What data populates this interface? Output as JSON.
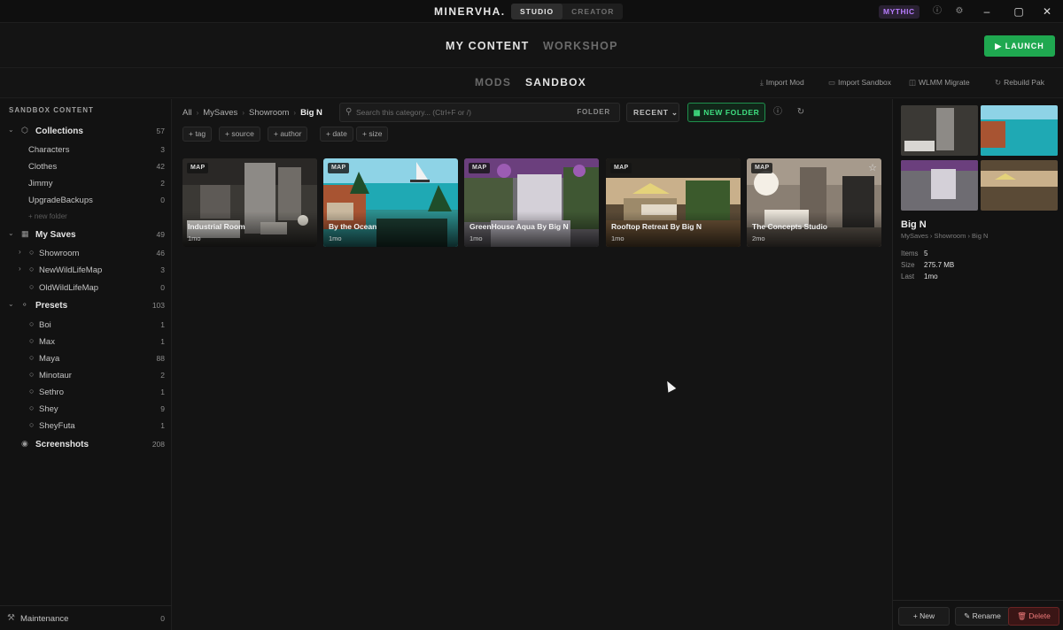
{
  "app": {
    "brand": "MINERVHA.",
    "modes": [
      "STUDIO",
      "CREATOR"
    ],
    "tier_badge": "MYTHIC"
  },
  "primary_nav": {
    "tabs": [
      "MY CONTENT",
      "WORKSHOP"
    ],
    "active": "MY CONTENT",
    "launch_label": "LAUNCH"
  },
  "secondary_nav": {
    "tabs": [
      "MODS",
      "SANDBOX"
    ],
    "active": "SANDBOX",
    "actions": [
      "Import Mod",
      "Import Sandbox",
      "WLMM Migrate",
      "Rebuild Pak"
    ]
  },
  "sidebar": {
    "header": "SANDBOX CONTENT",
    "collections": {
      "label": "Collections",
      "count": "57",
      "items": [
        {
          "label": "Characters",
          "count": "3"
        },
        {
          "label": "Clothes",
          "count": "42"
        },
        {
          "label": "Jimmy",
          "count": "2"
        },
        {
          "label": "UpgradeBackups",
          "count": "0"
        }
      ],
      "new_folder": "+ new folder"
    },
    "my_saves": {
      "label": "My Saves",
      "count": "49",
      "items": [
        {
          "label": "Showroom",
          "count": "46"
        },
        {
          "label": "NewWildLifeMap",
          "count": "3"
        },
        {
          "label": "OldWildLifeMap",
          "count": "0"
        }
      ]
    },
    "presets": {
      "label": "Presets",
      "count": "103",
      "items": [
        {
          "label": "Boi",
          "count": "1"
        },
        {
          "label": "Max",
          "count": "1"
        },
        {
          "label": "Maya",
          "count": "88"
        },
        {
          "label": "Minotaur",
          "count": "2"
        },
        {
          "label": "Sethro",
          "count": "1"
        },
        {
          "label": "Shey",
          "count": "9"
        },
        {
          "label": "SheyFuta",
          "count": "1"
        }
      ]
    },
    "screenshots": {
      "label": "Screenshots",
      "count": "208"
    },
    "maintenance": {
      "label": "Maintenance",
      "count": "0"
    }
  },
  "toolbar": {
    "breadcrumbs": [
      "All",
      "MySaves",
      "Showroom",
      "Big N"
    ],
    "search_placeholder": "Search this category... (Ctrl+F or /)",
    "search_scope": "FOLDER",
    "sort_label": "RECENT",
    "new_folder_label": "NEW FOLDER",
    "filters": [
      "+ tag",
      "+ source",
      "+ author",
      "+ date",
      "+ size"
    ]
  },
  "items": [
    {
      "badge": "MAP",
      "title": "Industrial Room",
      "age": "1mo"
    },
    {
      "badge": "MAP",
      "title": "By the Ocean",
      "age": "1mo"
    },
    {
      "badge": "MAP",
      "title": "GreenHouse Aqua By Big N",
      "age": "1mo"
    },
    {
      "badge": "MAP",
      "title": "Rooftop Retreat By Big N",
      "age": "1mo"
    },
    {
      "badge": "MAP",
      "title": "The Concepts Studio",
      "age": "2mo"
    }
  ],
  "details": {
    "title": "Big N",
    "path": "MySaves › Showroom › Big N",
    "rows": [
      {
        "key": "Items",
        "value": "5"
      },
      {
        "key": "Size",
        "value": "275.7 MB"
      },
      {
        "key": "Last",
        "value": "1mo"
      }
    ],
    "buttons": [
      "New",
      "Rename",
      "Delete"
    ]
  },
  "colors": {
    "accent_green": "#1fa850",
    "tier_purple": "#b77cff",
    "danger_red": "#ee7a7a"
  }
}
